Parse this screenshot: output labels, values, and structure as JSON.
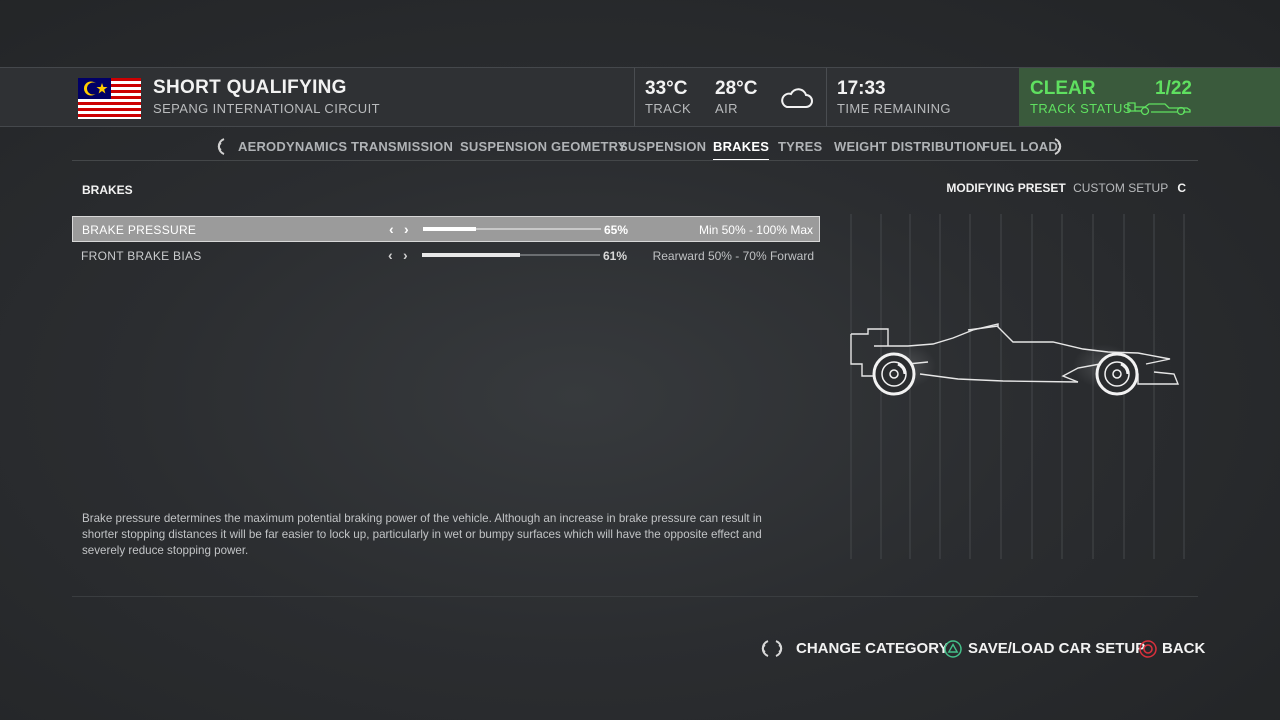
{
  "header": {
    "session_title": "SHORT QUALIFYING",
    "circuit": "SEPANG INTERNATIONAL CIRCUIT",
    "track_temp": "33°C",
    "track_label": "TRACK",
    "air_temp": "28°C",
    "air_label": "AIR",
    "weather_icon": "cloud-icon",
    "time_remaining": "17:33",
    "time_label": "TIME REMAINING",
    "status": "CLEAR",
    "lap": "1/22",
    "status_label": "TRACK STATUS",
    "status_color": "#5fe060"
  },
  "tabs": {
    "items": [
      {
        "label": "AERODYNAMICS"
      },
      {
        "label": "TRANSMISSION"
      },
      {
        "label": "SUSPENSION GEOMETRY"
      },
      {
        "label": "SUSPENSION"
      },
      {
        "label": "BRAKES"
      },
      {
        "label": "TYRES"
      },
      {
        "label": "WEIGHT DISTRIBUTION"
      },
      {
        "label": "FUEL LOAD"
      }
    ],
    "active": "BRAKES"
  },
  "panel": {
    "section_title": "BRAKES",
    "preset_key": "MODIFYING PRESET",
    "preset_value": "CUSTOM SETUP",
    "preset_letter": "C",
    "settings": [
      {
        "label": "BRAKE PRESSURE",
        "value": "65%",
        "fill": 0.3,
        "range": "Min 50% - 100% Max"
      },
      {
        "label": "FRONT BRAKE BIAS",
        "value": "61%",
        "fill": 0.55,
        "range": "Rearward 50% - 70% Forward"
      }
    ],
    "description": "Brake pressure determines the maximum potential braking power of the vehicle. Although an increase in brake pressure can result in shorter stopping distances it will be far easier to lock up, particularly in wet or bumpy surfaces which will have the opposite effect and severely reduce stopping power."
  },
  "footer": {
    "change_category": "CHANGE CATEGORY",
    "save_load": "SAVE/LOAD CAR SETUP",
    "back": "BACK"
  }
}
